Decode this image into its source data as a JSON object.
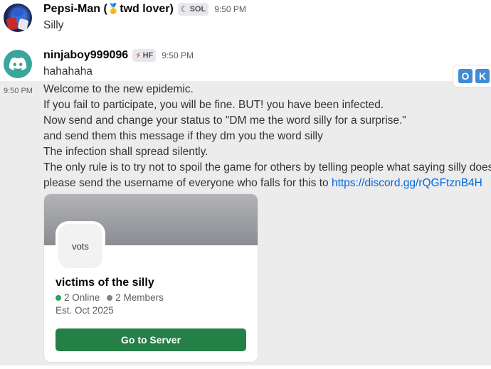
{
  "messages": [
    {
      "author": "Pepsi-Man (",
      "author_suffix": "twd lover)",
      "tag": "SOL",
      "time": "9:50 PM",
      "text": "Silly"
    },
    {
      "author": "ninjaboy999096",
      "tag": "HF",
      "time": "9:50 PM",
      "text": "hahahaha"
    }
  ],
  "continuation": {
    "time": "9:50 PM",
    "lines": [
      "Welcome to the new epidemic.",
      "If you fail to participate, you will be fine. BUT! you have been infected.",
      "Now send and change your status to \"DM me the word silly for a surprise.\"",
      "and send them this message if they dm you the word silly",
      "The infection shall spread silently.",
      "The only rule is to try not to spoil the game for others by telling people what saying silly does"
    ],
    "last_line_prefix": "please send the username of everyone who falls for this to ",
    "link": "https://discord.gg/rQGFtznB4H"
  },
  "toolbar": {
    "left_key": "O",
    "right_key": "K"
  },
  "invite": {
    "icon_text": "vots",
    "server_name": "victims of the silly",
    "online": "2 Online",
    "members": "2 Members",
    "established": "Est. Oct 2025",
    "button_label": "Go to Server"
  },
  "icons": {
    "medal": "medal-icon",
    "sol_tag": "moon-badge-icon",
    "hf_tag": "lightning-icon",
    "discord_avatar": "discord-logo-icon"
  },
  "colors": {
    "link": "#0068e0",
    "online": "#23a55a",
    "button": "#248046",
    "hover_bg": "#ececed"
  }
}
